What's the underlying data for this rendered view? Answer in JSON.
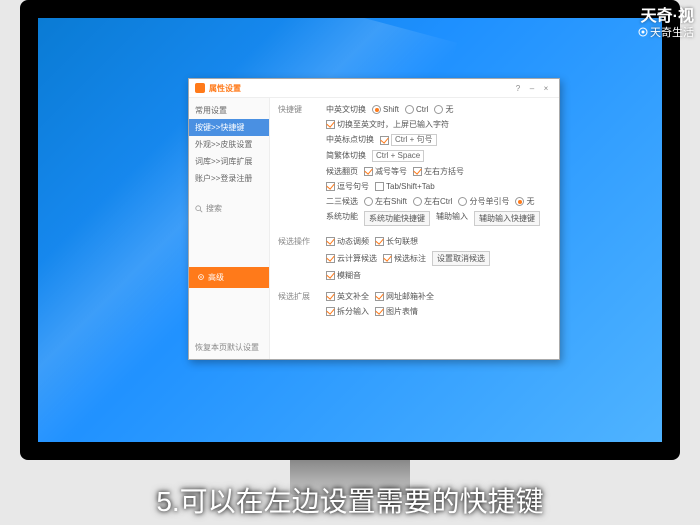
{
  "watermark": {
    "top": "天奇·视",
    "sub": "天奇生活"
  },
  "caption": "5.可以在左边设置需要的快捷键",
  "dialog": {
    "title": "属性设置",
    "winbtns": {
      "help": "?",
      "min": "–",
      "close": "×"
    },
    "side": {
      "items": [
        "常用设置",
        "按键>>快捷键",
        "外观>>皮肤设置",
        "词库>>词库扩展",
        "账户>>登录注册"
      ],
      "search": "搜索",
      "action": "高级",
      "reset": "恢复本页默认设置"
    },
    "sections": {
      "hotkeys": {
        "label": "快捷键",
        "switch": {
          "label": "中英文切换",
          "opts": [
            "Shift",
            "Ctrl",
            "无"
          ],
          "sel": 0,
          "note": "切换至英文时，上屏已输入字符"
        },
        "fullHalf": {
          "label": "中英标点切换",
          "val": "Ctrl + 句号"
        },
        "simpTrad": {
          "label": "简繁体切换",
          "val": "Ctrl + Space"
        },
        "page": {
          "label": "候选翻页",
          "opts": [
            "减号等号",
            "左右方括号",
            "逗号句号",
            "Tab/Shift+Tab"
          ]
        },
        "assist": {
          "label": "二三候选",
          "opts": [
            "左右Shift",
            "左右Ctrl",
            "分号单引号",
            "无"
          ]
        },
        "sysFunc": {
          "label": "系统功能",
          "btn1": "系统功能快捷键",
          "lbl2": "辅助输入",
          "btn2": "辅助输入快捷键"
        }
      },
      "candidate": {
        "label": "候选操作",
        "opts": [
          "动态调频",
          "长句联想",
          "云计算候选",
          "候选标注"
        ],
        "btn": "设置取消候选"
      },
      "fuzzy": {
        "label": "",
        "opt": "模糊音"
      },
      "expand": {
        "label": "候选扩展",
        "opts": [
          "英文补全",
          "网址邮箱补全",
          "拆分输入",
          "图片表情"
        ]
      }
    }
  }
}
